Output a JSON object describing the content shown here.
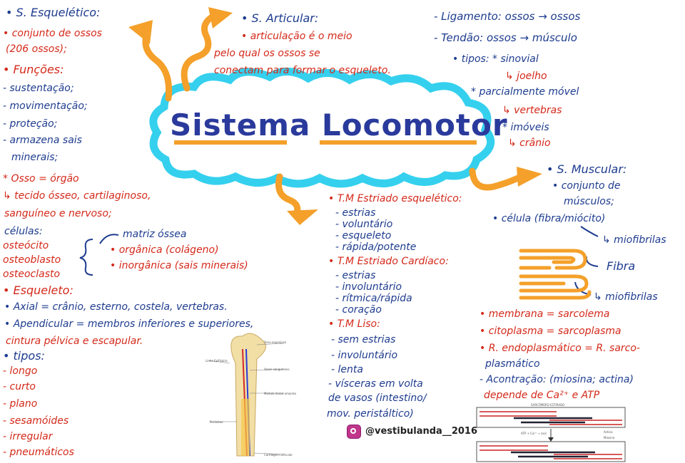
{
  "title": "Sistema Locomotor",
  "esqueletico": {
    "heading": "• S. Esquelético:",
    "l1": "• conjunto de ossos",
    "l2": "(206 ossos);",
    "funcoes": "• Funções:",
    "f1": "- sustentação;",
    "f2": "- movimentação;",
    "f3": "- proteção;",
    "f4": "- armazena sais",
    "f5": "minerais;",
    "osso1": "* Osso = órgão",
    "osso2": "↳ tecido ósseo, cartilaginoso,",
    "osso3": "sanguíneo e nervoso;",
    "celulas": "células:",
    "c1": "osteócito",
    "c2": "osteoblasto",
    "c3": "osteoclasto",
    "m1": "matriz óssea",
    "m2": "• orgânica (colágeno)",
    "m3": "• inorgânica (sais minerais)",
    "esq": "• Esqueleto:",
    "axial": "• Axial = crânio, esterno, costela, vertebras.",
    "apend1": "• Apendicular = membros inferiores e superiores,",
    "apend2": "cintura pélvica e escapular.",
    "tipos": "• tipos:",
    "t1": "- longo",
    "t2": "- curto",
    "t3": "- plano",
    "t4": "- sesamóides",
    "t5": "- irregular",
    "t6": "- pneumáticos"
  },
  "articular": {
    "heading": "• S. Articular:",
    "l1": "• articulação é o meio",
    "l2": "pelo qual os ossos se",
    "l3": "conectam para formar o esqueleto."
  },
  "ligamento": {
    "l1": "- Ligamento: ossos → ossos",
    "l2": "- Tendão: ossos → músculo",
    "tipos": "• tipos: * sinovial",
    "s1": "↳ joelho",
    "parc": "* parcialmente móvel",
    "s2": "↳ vertebras",
    "imov": "* imóveis",
    "s3": "↳ crânio"
  },
  "muscular": {
    "heading": "• S. Muscular:",
    "l1": "• conjunto de",
    "l2": "músculos;",
    "celula": "• célula (fibra/miócito)",
    "miofibrilas": "↳ miofibrilas",
    "fibra": "Fibra",
    "miofibrilas2": "↳ miofibrilas",
    "membrana": "• membrana = sarcolema",
    "citoplasma": "• citoplasma = sarcoplasma",
    "ret1": "• R. endoplasmático = R. sarco-",
    "ret2": "plasmático",
    "contracao": "- Acontração: (miosina; actina)",
    "depende": "depende de Ca²⁺ e ATP"
  },
  "tecidos": {
    "esq_head": "• T.M Estriado esquelético:",
    "e1": "- estrias",
    "e2": "- voluntário",
    "e3": "- esqueleto",
    "e4": "- rápida/potente",
    "card_head": "• T.M Estriado Cardíaco:",
    "c1": "- estrias",
    "c2": "- involuntário",
    "c3": "- rítmica/rápida",
    "c4": "- coração",
    "liso_head": "• T.M Liso:",
    "l1": "- sem estrias",
    "l2": "- involuntário",
    "l3": "- lenta",
    "l4": "- vísceras em volta",
    "l5": "de vasos (intestino/",
    "l6": "mov. peristáltico)"
  },
  "bone_labels": {
    "a": "Osso esponjoso",
    "b": "Linha Epifisária",
    "c": "Vasos sanguíneos",
    "d": "Medula óssea amarela",
    "e": "Periósteo",
    "f": "Cartilagem articular"
  },
  "sarcomero": {
    "title": "SARCÔMERO ESTIRADO",
    "formula": "ATP + Ca²⁺ → sarc",
    "k1": "Actina",
    "k2": "Miosina"
  },
  "credit": "@vestibulanda__2016",
  "colors": {
    "red": "#d4291a",
    "blue": "#1e3c8f",
    "orange": "#f4a02a",
    "cloud": "#35d0ee"
  }
}
